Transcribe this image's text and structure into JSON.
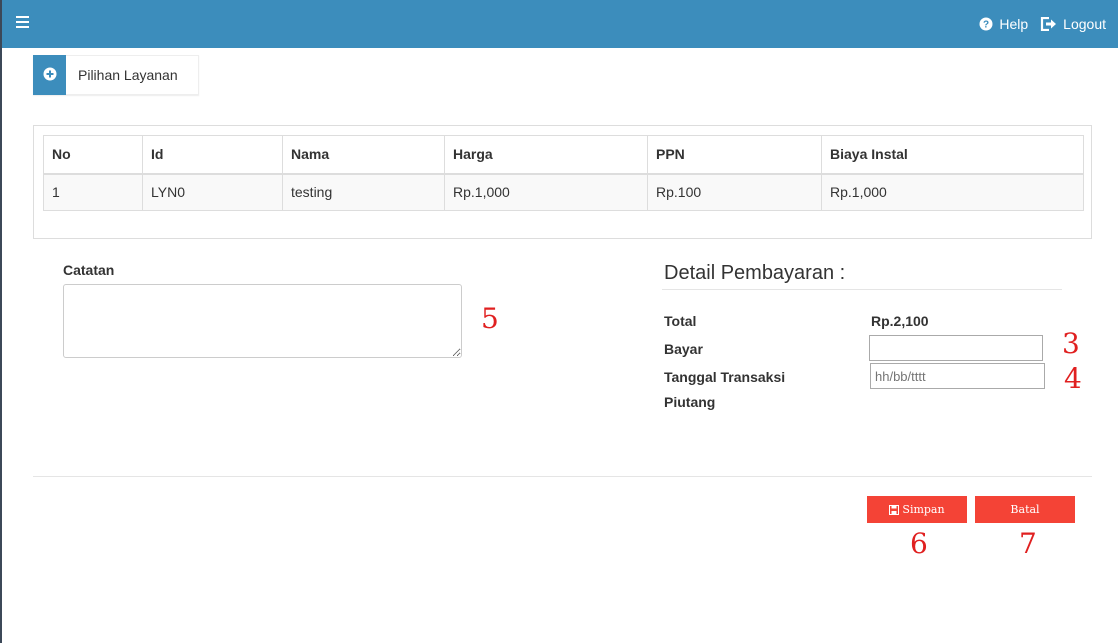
{
  "navbar": {
    "help_label": "Help",
    "logout_label": "Logout"
  },
  "service_button": {
    "label": "Pilihan Layanan"
  },
  "table": {
    "headers": [
      "No",
      "Id",
      "Nama",
      "Harga",
      "PPN",
      "Biaya Instal"
    ],
    "rows": [
      [
        "1",
        "LYN0",
        "testing",
        "Rp.1,000",
        "Rp.100",
        "Rp.1,000"
      ]
    ]
  },
  "notes": {
    "label": "Catatan",
    "value": ""
  },
  "payment": {
    "title": "Detail Pembayaran :",
    "total_label": "Total",
    "total_value": "Rp.2,100",
    "bayar_label": "Bayar",
    "bayar_value": "",
    "tanggal_label": "Tanggal Transaksi",
    "tanggal_placeholder": "hh/bb/tttt",
    "piutang_label": "Piutang"
  },
  "actions": {
    "save_label": "Simpan",
    "cancel_label": "Batal"
  },
  "annotations": [
    "3",
    "4",
    "5",
    "6",
    "7"
  ],
  "colors": {
    "primary": "#3c8dbc",
    "danger": "#f44336",
    "annotation": "#e02020"
  }
}
